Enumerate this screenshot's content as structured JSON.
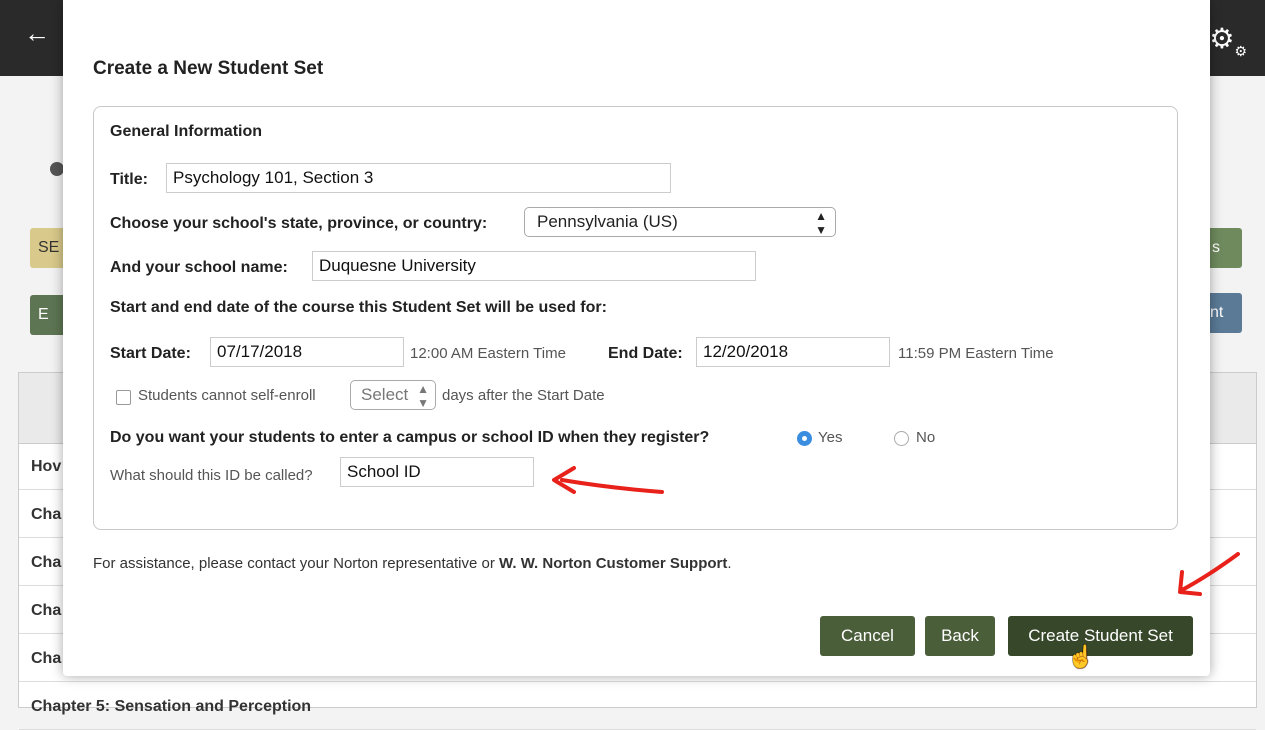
{
  "background": {
    "left_btn_1": "SE",
    "left_btn_2": "E",
    "right_btn_1": "s",
    "right_btn_2": "nt",
    "rows": [
      "Hov",
      "Cha",
      "Cha",
      "Cha",
      "Cha",
      "Chapter 5: Sensation and Perception"
    ]
  },
  "modal": {
    "title": "Create a New Student Set",
    "section_title": "General Information",
    "title_label": "Title:",
    "title_value": "Psychology 101, Section 3",
    "state_label": "Choose your school's state, province, or country:",
    "state_value": "Pennsylvania (US)",
    "school_label": "And your school name:",
    "school_value": "Duquesne University",
    "dates_heading": "Start and end date of the course this Student Set will be used for:",
    "start_label": "Start Date:",
    "start_value": "07/17/2018",
    "start_time": "12:00 AM Eastern Time",
    "end_label": "End Date:",
    "end_value": "12/20/2018",
    "end_time": "11:59 PM Eastern Time",
    "self_enroll_label": "Students cannot self-enroll",
    "self_enroll_select": "Select",
    "self_enroll_suffix": "days after the Start Date",
    "id_question": "Do you want your students to enter a campus or school ID when they register?",
    "yes_label": "Yes",
    "no_label": "No",
    "id_name_label": "What should this ID be called?",
    "id_name_value": "School ID",
    "assist_text": "For assistance, please contact your Norton representative or ",
    "assist_link": "W. W. Norton Customer Support",
    "assist_end": ".",
    "cancel": "Cancel",
    "back": "Back",
    "create": "Create Student Set"
  },
  "colors": {
    "button": "#4b5e3a",
    "accent": "#3b8de0",
    "arrow": "#e8221b"
  }
}
